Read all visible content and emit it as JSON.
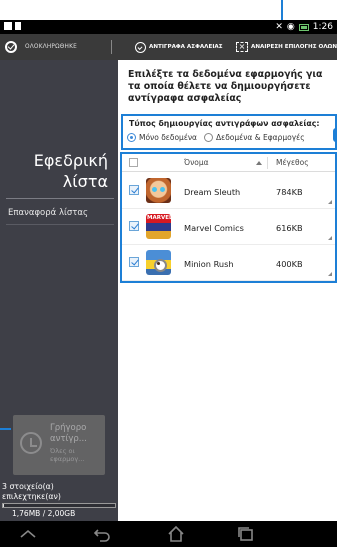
{
  "status_bar": {
    "time": "1:26"
  },
  "action_bar": {
    "done_label": "ΟΛΟΚΛΗΡΩΘΗΚΕ",
    "backup_label": "ΑΝΤΙΓΡΑΦΑ ΑΣΦΑΛΕΙΑΣ",
    "deselect_label": "ΑΝΑΙΡΕΣΗ ΕΠΙΛΟΓΗΣ ΟΛΩΝ"
  },
  "sidebar": {
    "title_line1": "Εφεδρική",
    "title_line2": "λίστα",
    "restore_list": "Επαναφορά λίστας",
    "quick_backup_title": "Γρήγορο αντίγρ...",
    "quick_backup_sub": "Όλες οι εφαρμογ...",
    "selected_count": "3 στοιχείο(α) επιλεχτηκε(αν)",
    "storage_used": "1,76MB / 2,00GB",
    "storage_fraction": 0.0009
  },
  "main": {
    "instruction": "Επιλέξτε τα δεδομένα εφαρμογής για τα οποία θέλετε να δημιουργήσετε αντίγραφα ασφαλείας",
    "backup_type_title": "Τύπος δημιουργίας αντιγράφων ασφαλείας:",
    "option_data_only": "Μόνο δεδομένα",
    "option_data_and_apps": "Δεδομένα & Εφαρμογές",
    "selected_option": "data_only",
    "table_header": {
      "name": "Όνομα",
      "size": "Μέγεθος"
    },
    "apps": [
      {
        "name": "Dream Sleuth",
        "size": "784KB",
        "checked": true,
        "icon": "dream-sleuth-icon"
      },
      {
        "name": "Marvel Comics",
        "size": "616KB",
        "checked": true,
        "icon": "marvel-comics-icon"
      },
      {
        "name": "Minion Rush",
        "size": "400KB",
        "checked": true,
        "icon": "minion-rush-icon"
      }
    ]
  },
  "marvel_icon_text": "MARVEL",
  "colors": {
    "accent": "#1d7fd6",
    "sidebar": "#3e3f47",
    "actionbar": "#3a3a3a"
  }
}
